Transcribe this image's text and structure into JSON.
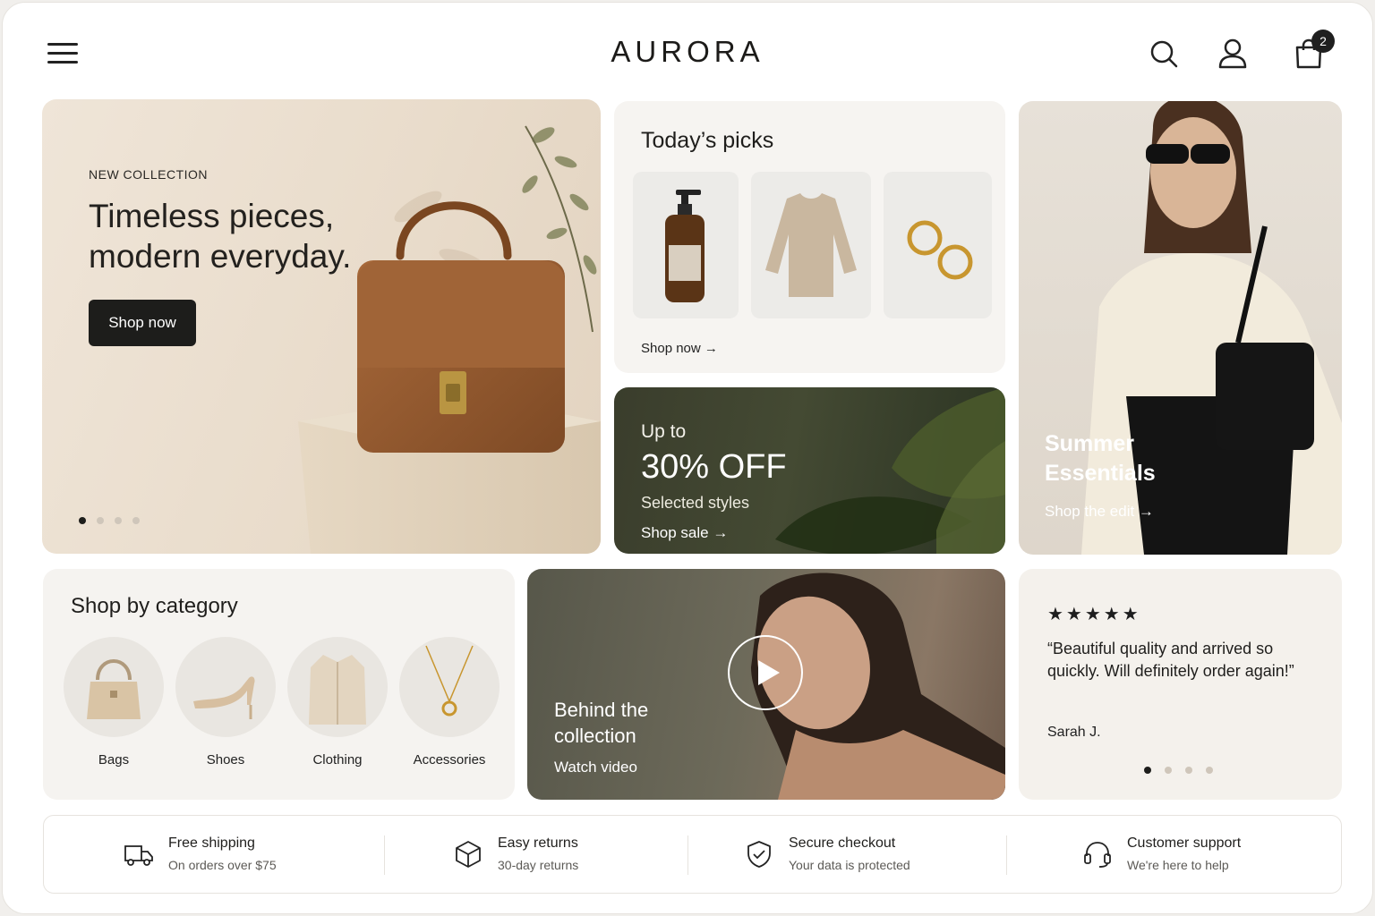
{
  "header": {
    "brand": "AURORA",
    "cart_count": "2",
    "icons": [
      "menu-icon",
      "search-icon",
      "user-icon",
      "shopping-bag-icon"
    ]
  },
  "hero": {
    "eyebrow": "NEW COLLECTION",
    "title": "Timeless pieces, modern everyday.",
    "button": "Shop now",
    "slide_count": 4,
    "active_slide": 1
  },
  "picks": {
    "title": "Today’s picks",
    "items": [
      "soap-bottle",
      "knit-sweater",
      "gold-hoop-earrings"
    ],
    "link": "Shop now →"
  },
  "sale": {
    "upto": "Up to",
    "headline": "30% OFF",
    "subtitle": "Selected styles",
    "link": "Shop sale →"
  },
  "summer": {
    "title": "Summer Essentials",
    "link": "Shop the edit →"
  },
  "category": {
    "title": "Shop by category",
    "items": [
      {
        "label": "Bags"
      },
      {
        "label": "Shoes"
      },
      {
        "label": "Clothing"
      },
      {
        "label": "Accessories"
      }
    ]
  },
  "video": {
    "title": "Behind the collection",
    "link": "Watch video"
  },
  "review": {
    "stars": "★★★★★",
    "rating": 5,
    "quote": "“Beautiful quality and arrived so quickly. Will definitely order again!”",
    "author": "Sarah J.",
    "slide_count": 4,
    "active_slide": 1
  },
  "features": [
    {
      "title": "Free shipping",
      "subtitle": "On orders over $75",
      "icon": "truck-icon"
    },
    {
      "title": "Easy returns",
      "subtitle": "30-day returns",
      "icon": "box-icon"
    },
    {
      "title": "Secure checkout",
      "subtitle": "Your data is protected",
      "icon": "shield-check-icon"
    },
    {
      "title": "Customer support",
      "subtitle": "We're here to help",
      "icon": "headset-icon"
    }
  ],
  "colors": {
    "dark": "#1d1d1b",
    "sale_green": "#3a3d2c",
    "hero_beige": "#e9dccb"
  }
}
